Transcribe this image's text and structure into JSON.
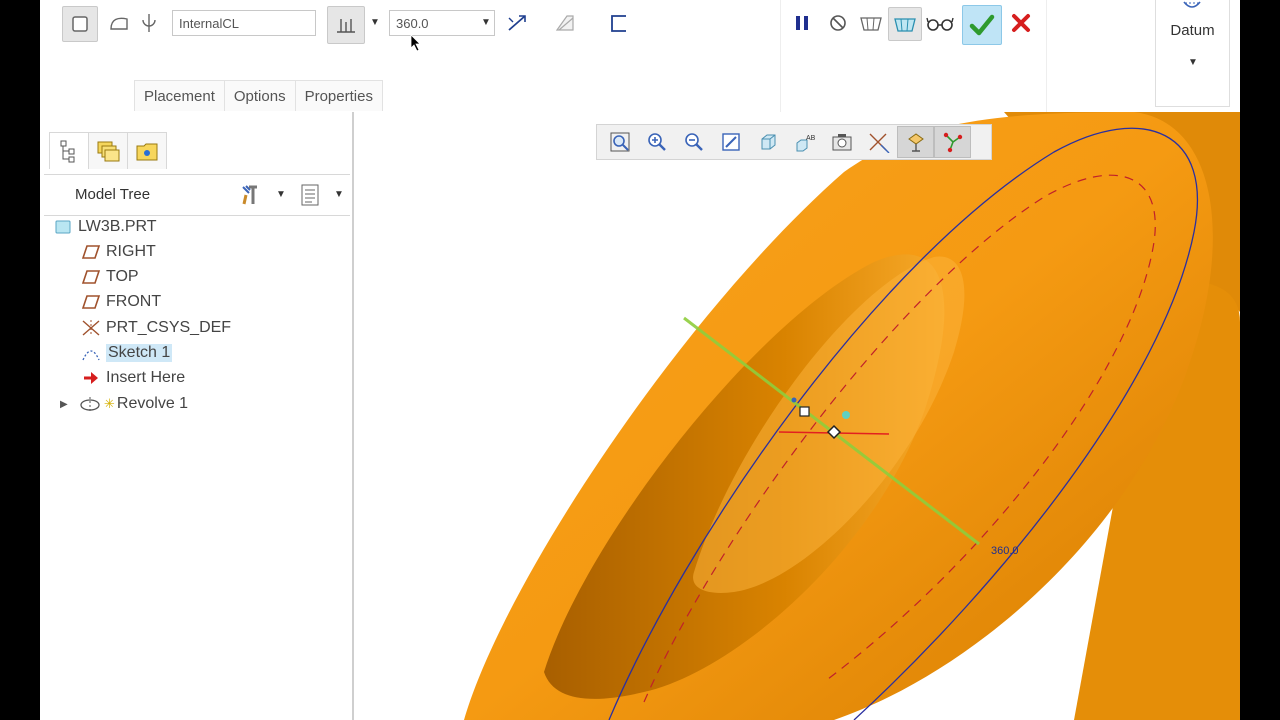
{
  "ribbon": {
    "axis_field": "InternalCL",
    "angle_value": "360.0",
    "tabs": [
      "Placement",
      "Options",
      "Properties"
    ],
    "datum_label": "Datum",
    "confirm_color": "#2e9a2e",
    "cancel_color": "#d61e1e",
    "pause_color": "#1f2f8f"
  },
  "model_tree": {
    "title": "Model Tree",
    "items": [
      {
        "label": "LW3B.PRT",
        "icon": "part-icon"
      },
      {
        "label": "RIGHT",
        "icon": "datum-plane-icon"
      },
      {
        "label": "TOP",
        "icon": "datum-plane-icon"
      },
      {
        "label": "FRONT",
        "icon": "datum-plane-icon"
      },
      {
        "label": "PRT_CSYS_DEF",
        "icon": "csys-icon"
      },
      {
        "label": "Sketch 1",
        "icon": "sketch-icon",
        "selected": true
      },
      {
        "label": "Insert Here",
        "icon": "insert-arrow-icon"
      },
      {
        "label": "Revolve 1",
        "icon": "revolve-icon"
      }
    ]
  },
  "graphics": {
    "angle_annotation": "360.0",
    "model_color": "#f59a12"
  }
}
